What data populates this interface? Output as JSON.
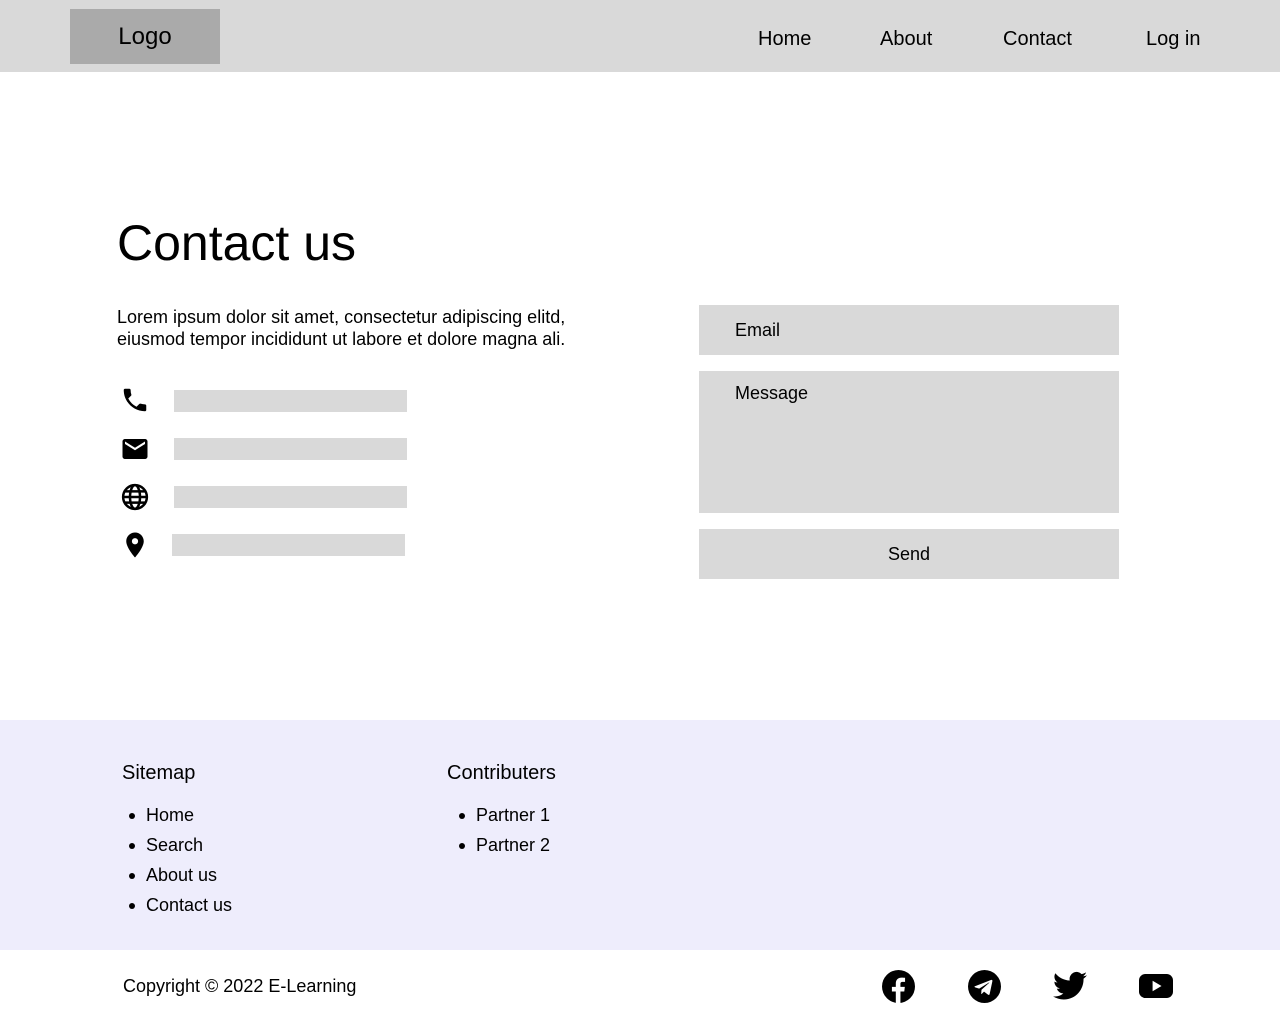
{
  "header": {
    "logo": "Logo",
    "nav": [
      "Home",
      "About",
      "Contact",
      "Log in"
    ]
  },
  "main": {
    "title": "Contact us",
    "intro": "Lorem ipsum dolor sit amet, consectetur adipiscing elitd, eiusmod tempor incididunt ut labore et dolore magna ali.",
    "contact_info": [
      {
        "icon": "phone-icon"
      },
      {
        "icon": "mail-icon"
      },
      {
        "icon": "globe-icon"
      },
      {
        "icon": "location-pin-icon"
      }
    ],
    "form": {
      "email_placeholder": "Email",
      "message_placeholder": "Message",
      "send_label": "Send"
    }
  },
  "footer": {
    "sitemap": {
      "heading": "Sitemap",
      "items": [
        "Home",
        "Search",
        "About us",
        "Contact us"
      ]
    },
    "contributors": {
      "heading": "Contributers",
      "items": [
        "Partner 1",
        "Partner 2"
      ]
    },
    "copyright": "Copyright © 2022 E-Learning",
    "social": [
      "facebook-icon",
      "telegram-icon",
      "twitter-icon",
      "youtube-icon"
    ]
  },
  "colors": {
    "header_bg": "#d9d9d9",
    "logo_bg": "#aaaaaa",
    "field_bg": "#d9d9d9",
    "footer_bg": "#eeedfc"
  }
}
